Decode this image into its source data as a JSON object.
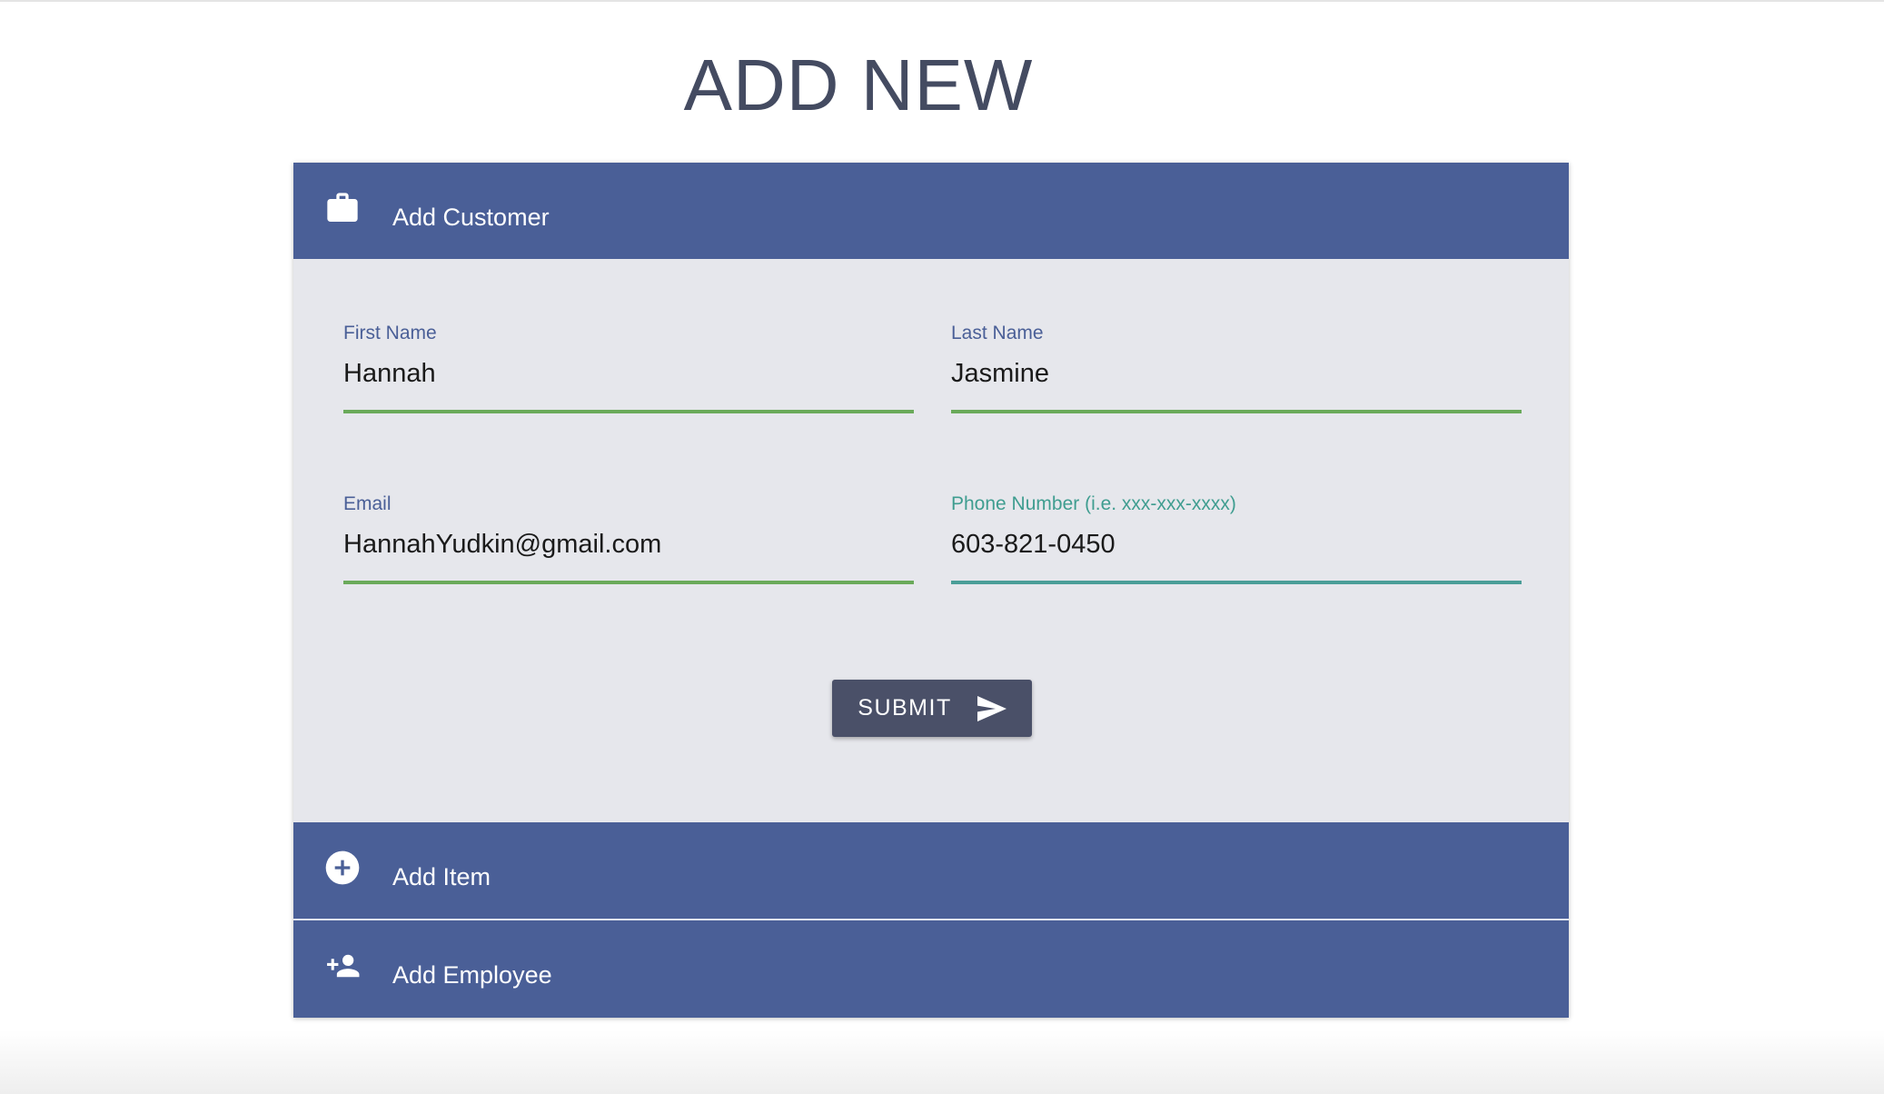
{
  "page": {
    "title": "ADD NEW"
  },
  "colors": {
    "header_bg": "#4a5f97",
    "body_bg": "#e6e7ec",
    "label_color": "#4a5f97",
    "active_label_color": "#3f9d90",
    "valid_underline": "#6aaa5a",
    "active_underline": "#4a9e98",
    "button_bg": "#4a5068",
    "title_color": "#444b61"
  },
  "accordion": {
    "customer": {
      "label": "Add Customer",
      "icon": "briefcase-icon",
      "expanded": true,
      "form": {
        "first_name": {
          "label": "First Name",
          "value": "Hannah"
        },
        "last_name": {
          "label": "Last Name",
          "value": "Jasmine"
        },
        "email": {
          "label": "Email",
          "value": "HannahYudkin@gmail.com"
        },
        "phone": {
          "label": "Phone Number (i.e. xxx-xxx-xxxx)",
          "value": "603-821-0450",
          "focused": true
        }
      },
      "submit": {
        "label": "SUBMIT",
        "icon": "send-icon"
      }
    },
    "item": {
      "label": "Add Item",
      "icon": "add-circle-icon",
      "expanded": false
    },
    "employee": {
      "label": "Add Employee",
      "icon": "person-add-icon",
      "expanded": false
    }
  }
}
